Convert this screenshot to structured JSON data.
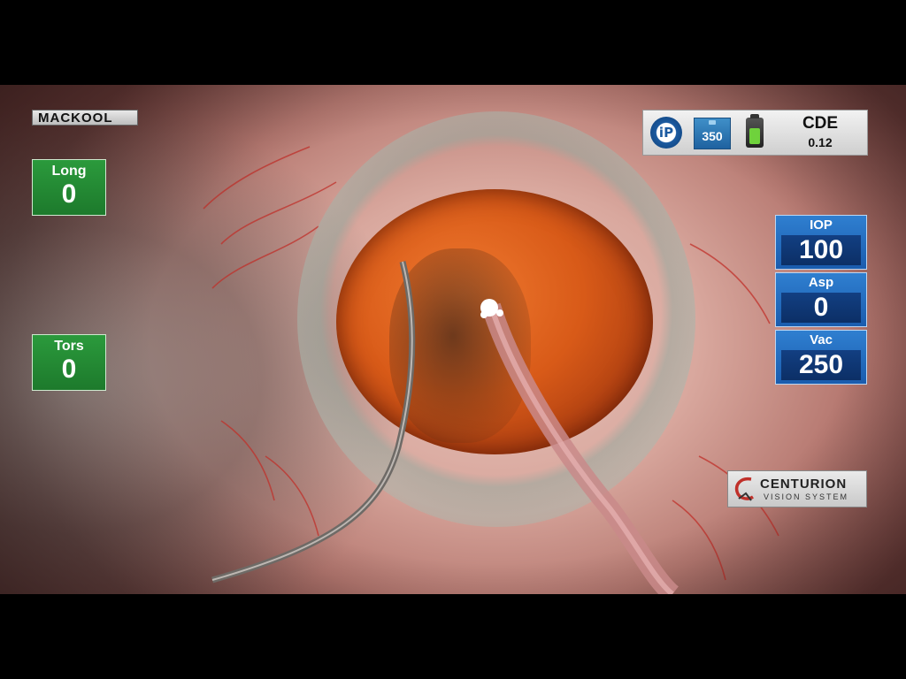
{
  "surgeon": {
    "name": "MACKOOL"
  },
  "axis_tiles": [
    {
      "label": "Long",
      "value": "0"
    },
    {
      "label": "Tors",
      "value": "0"
    }
  ],
  "status": {
    "ip_icon_text": "iP",
    "power_badge": "350",
    "battery_level": 0.8,
    "cde_label": "CDE",
    "cde_value": "0.12"
  },
  "params": [
    {
      "label": "IOP",
      "value": "100"
    },
    {
      "label": "Asp",
      "value": "0"
    },
    {
      "label": "Vac",
      "value": "250"
    }
  ],
  "brand": {
    "name": "CENTURION",
    "subtitle": "VISION SYSTEM"
  },
  "colors": {
    "axis_tile": "#2b9a3c",
    "param_tile": "#2f7fd0",
    "param_value_bg": "#123f82"
  }
}
